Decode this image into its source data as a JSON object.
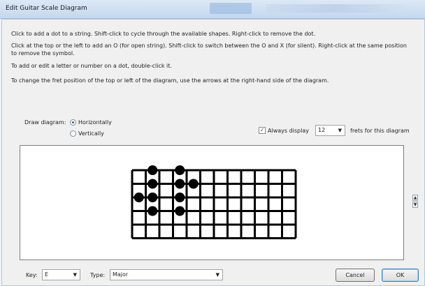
{
  "window": {
    "title": "Edit Guitar Scale Diagram"
  },
  "instructions": {
    "line1": "Click to add a dot to a string. Shift-click to cycle through the available shapes. Right-click to remove the dot.",
    "line2": "Click at the top or the left to add an O (for open string). Shift-click to switch between the O and X (for silent). Right-click at the same position to remove the symbol.",
    "line3": "To add or edit a letter or number on a dot, double-click it.",
    "line4": "To change the fret position of the top or left of the diagram, use the arrows at the right-hand side of the diagram."
  },
  "orientation": {
    "label": "Draw diagram:",
    "options": [
      "Horizontally",
      "Vertically"
    ],
    "selected": "Horizontally"
  },
  "frets": {
    "always_display_label": "Always display",
    "always_display_checked": true,
    "value": "12",
    "suffix": "frets for this diagram"
  },
  "diagram": {
    "strings": 6,
    "frets": 12,
    "dots": [
      {
        "string": 1,
        "fret": 2
      },
      {
        "string": 1,
        "fret": 4
      },
      {
        "string": 2,
        "fret": 2
      },
      {
        "string": 2,
        "fret": 4
      },
      {
        "string": 2,
        "fret": 5
      },
      {
        "string": 3,
        "fret": 1
      },
      {
        "string": 3,
        "fret": 2
      },
      {
        "string": 3,
        "fret": 4
      },
      {
        "string": 4,
        "fret": 2
      },
      {
        "string": 4,
        "fret": 4
      }
    ],
    "colors": {
      "background": "#ffffff",
      "lines": "#000000",
      "dots": "#000000"
    }
  },
  "bottom": {
    "key_label": "Key:",
    "key_value": "E",
    "type_label": "Type:",
    "type_value": "Major",
    "cancel_label": "Cancel",
    "ok_label": "OK"
  },
  "icons": {
    "dropdown": "chevron-down-icon",
    "spin_up": "arrow-up-icon",
    "spin_down": "arrow-down-icon"
  }
}
